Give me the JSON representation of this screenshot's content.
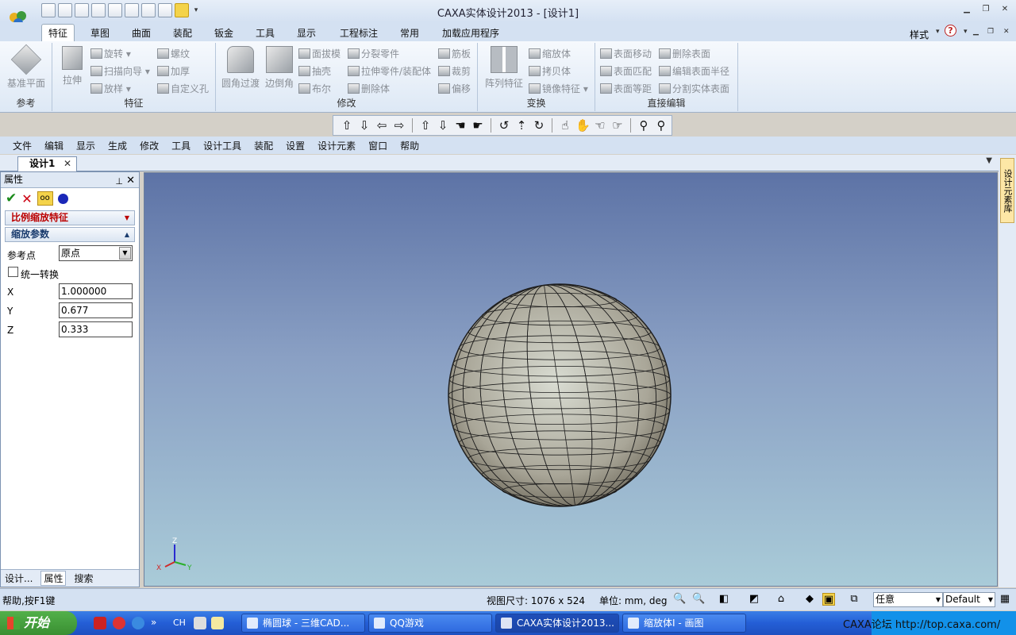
{
  "window": {
    "title": "CAXA实体设计2013 - [设计1]"
  },
  "ribbon": {
    "tabs": [
      "特征",
      "草图",
      "曲面",
      "装配",
      "钣金",
      "工具",
      "显示",
      "工程标注",
      "常用",
      "加载应用程序"
    ],
    "style_label": "样式",
    "groups": {
      "reference": {
        "label": "参考",
        "datum_plane": "基准平面"
      },
      "feature": {
        "label": "特征",
        "extrude": "拉伸",
        "revolve": "旋转",
        "sweep": "扫描向导",
        "loft": "放样",
        "thread": "螺纹",
        "thicken": "加厚",
        "custom_hole": "自定义孔"
      },
      "modify": {
        "label": "修改",
        "fillet": "圆角过渡",
        "chamfer": "边倒角",
        "draft": "面拔模",
        "shell": "抽壳",
        "boolean": "布尔",
        "split_part": "分裂零件",
        "stretch": "拉伸零件/装配体",
        "delete_body": "删除体",
        "rib": "筋板",
        "trim": "裁剪",
        "offset": "偏移"
      },
      "transform": {
        "label": "变换",
        "pattern": "阵列特征",
        "scale": "缩放体",
        "copy": "拷贝体",
        "mirror": "镜像特征"
      },
      "direct_edit": {
        "label": "直接编辑",
        "move_face": "表面移动",
        "match_face": "表面匹配",
        "offset_face": "表面等距",
        "delete_face": "删除表面",
        "edit_radius": "编辑表面半径",
        "split_solid_face": "分割实体表面"
      }
    }
  },
  "menubar": [
    "文件",
    "编辑",
    "显示",
    "生成",
    "修改",
    "工具",
    "设计工具",
    "装配",
    "设置",
    "设计元素",
    "窗口",
    "帮助"
  ],
  "doc_tab": {
    "label": "设计1"
  },
  "property_panel": {
    "title": "属性",
    "feature_title": "比例缩放特征",
    "section_title": "缩放参数",
    "ref_point_label": "参考点",
    "ref_point_value": "原点",
    "uniform_label": "统一转换",
    "uniform_checked": false,
    "x_label": "X",
    "x_value": "1.000000",
    "y_label": "Y",
    "y_value": "0.677",
    "z_label": "Z",
    "z_value": "0.333",
    "bottom_tabs": [
      "设计...",
      "属性",
      "搜索"
    ]
  },
  "right_strip": {
    "label": "设计元素库"
  },
  "viewport": {
    "axes": {
      "z": "Z",
      "x": "X",
      "y": "Y"
    }
  },
  "status": {
    "help": "帮助,按F1键",
    "view_size": "视图尺寸: 1076 x  524",
    "units": "单位: mm, deg",
    "filter": "任意",
    "scheme": "Default"
  },
  "taskbar": {
    "start": "开始",
    "ime": "CH",
    "items": [
      "椭圆球 - 三维CAD...",
      "QQ游戏",
      "CAXA实体设计2013...",
      "缩放体I - 画图"
    ],
    "watermark_url": "CAXA论坛 http://top.caxa.com/"
  },
  "colors": {
    "accent": "#f4d34a",
    "feature_title": "#b00000",
    "viewport_top": "#5d73a6",
    "viewport_bottom": "#a9cbd8"
  }
}
